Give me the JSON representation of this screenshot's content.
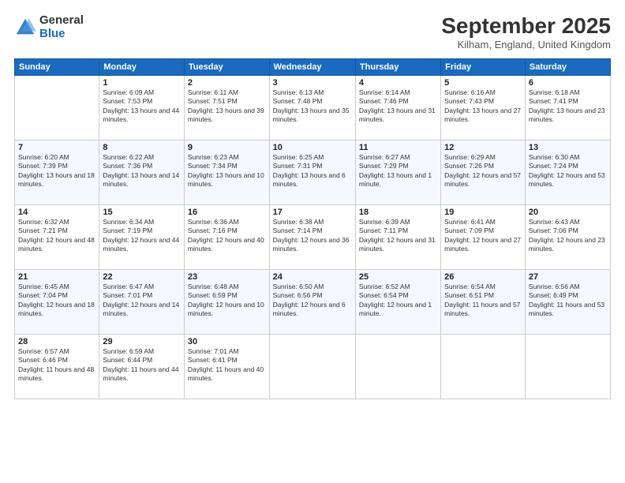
{
  "logo": {
    "general": "General",
    "blue": "Blue"
  },
  "title": "September 2025",
  "location": "Kilham, England, United Kingdom",
  "days_of_week": [
    "Sunday",
    "Monday",
    "Tuesday",
    "Wednesday",
    "Thursday",
    "Friday",
    "Saturday"
  ],
  "weeks": [
    [
      {
        "day": "",
        "sunrise": "",
        "sunset": "",
        "daylight": ""
      },
      {
        "day": "1",
        "sunrise": "Sunrise: 6:09 AM",
        "sunset": "Sunset: 7:53 PM",
        "daylight": "Daylight: 13 hours and 44 minutes."
      },
      {
        "day": "2",
        "sunrise": "Sunrise: 6:11 AM",
        "sunset": "Sunset: 7:51 PM",
        "daylight": "Daylight: 13 hours and 39 minutes."
      },
      {
        "day": "3",
        "sunrise": "Sunrise: 6:13 AM",
        "sunset": "Sunset: 7:48 PM",
        "daylight": "Daylight: 13 hours and 35 minutes."
      },
      {
        "day": "4",
        "sunrise": "Sunrise: 6:14 AM",
        "sunset": "Sunset: 7:46 PM",
        "daylight": "Daylight: 13 hours and 31 minutes."
      },
      {
        "day": "5",
        "sunrise": "Sunrise: 6:16 AM",
        "sunset": "Sunset: 7:43 PM",
        "daylight": "Daylight: 13 hours and 27 minutes."
      },
      {
        "day": "6",
        "sunrise": "Sunrise: 6:18 AM",
        "sunset": "Sunset: 7:41 PM",
        "daylight": "Daylight: 13 hours and 23 minutes."
      }
    ],
    [
      {
        "day": "7",
        "sunrise": "Sunrise: 6:20 AM",
        "sunset": "Sunset: 7:39 PM",
        "daylight": "Daylight: 13 hours and 18 minutes."
      },
      {
        "day": "8",
        "sunrise": "Sunrise: 6:22 AM",
        "sunset": "Sunset: 7:36 PM",
        "daylight": "Daylight: 13 hours and 14 minutes."
      },
      {
        "day": "9",
        "sunrise": "Sunrise: 6:23 AM",
        "sunset": "Sunset: 7:34 PM",
        "daylight": "Daylight: 13 hours and 10 minutes."
      },
      {
        "day": "10",
        "sunrise": "Sunrise: 6:25 AM",
        "sunset": "Sunset: 7:31 PM",
        "daylight": "Daylight: 13 hours and 6 minutes."
      },
      {
        "day": "11",
        "sunrise": "Sunrise: 6:27 AM",
        "sunset": "Sunset: 7:29 PM",
        "daylight": "Daylight: 13 hours and 1 minute."
      },
      {
        "day": "12",
        "sunrise": "Sunrise: 6:29 AM",
        "sunset": "Sunset: 7:26 PM",
        "daylight": "Daylight: 12 hours and 57 minutes."
      },
      {
        "day": "13",
        "sunrise": "Sunrise: 6:30 AM",
        "sunset": "Sunset: 7:24 PM",
        "daylight": "Daylight: 12 hours and 53 minutes."
      }
    ],
    [
      {
        "day": "14",
        "sunrise": "Sunrise: 6:32 AM",
        "sunset": "Sunset: 7:21 PM",
        "daylight": "Daylight: 12 hours and 48 minutes."
      },
      {
        "day": "15",
        "sunrise": "Sunrise: 6:34 AM",
        "sunset": "Sunset: 7:19 PM",
        "daylight": "Daylight: 12 hours and 44 minutes."
      },
      {
        "day": "16",
        "sunrise": "Sunrise: 6:36 AM",
        "sunset": "Sunset: 7:16 PM",
        "daylight": "Daylight: 12 hours and 40 minutes."
      },
      {
        "day": "17",
        "sunrise": "Sunrise: 6:38 AM",
        "sunset": "Sunset: 7:14 PM",
        "daylight": "Daylight: 12 hours and 36 minutes."
      },
      {
        "day": "18",
        "sunrise": "Sunrise: 6:39 AM",
        "sunset": "Sunset: 7:11 PM",
        "daylight": "Daylight: 12 hours and 31 minutes."
      },
      {
        "day": "19",
        "sunrise": "Sunrise: 6:41 AM",
        "sunset": "Sunset: 7:09 PM",
        "daylight": "Daylight: 12 hours and 27 minutes."
      },
      {
        "day": "20",
        "sunrise": "Sunrise: 6:43 AM",
        "sunset": "Sunset: 7:06 PM",
        "daylight": "Daylight: 12 hours and 23 minutes."
      }
    ],
    [
      {
        "day": "21",
        "sunrise": "Sunrise: 6:45 AM",
        "sunset": "Sunset: 7:04 PM",
        "daylight": "Daylight: 12 hours and 18 minutes."
      },
      {
        "day": "22",
        "sunrise": "Sunrise: 6:47 AM",
        "sunset": "Sunset: 7:01 PM",
        "daylight": "Daylight: 12 hours and 14 minutes."
      },
      {
        "day": "23",
        "sunrise": "Sunrise: 6:48 AM",
        "sunset": "Sunset: 6:59 PM",
        "daylight": "Daylight: 12 hours and 10 minutes."
      },
      {
        "day": "24",
        "sunrise": "Sunrise: 6:50 AM",
        "sunset": "Sunset: 6:56 PM",
        "daylight": "Daylight: 12 hours and 6 minutes."
      },
      {
        "day": "25",
        "sunrise": "Sunrise: 6:52 AM",
        "sunset": "Sunset: 6:54 PM",
        "daylight": "Daylight: 12 hours and 1 minute."
      },
      {
        "day": "26",
        "sunrise": "Sunrise: 6:54 AM",
        "sunset": "Sunset: 6:51 PM",
        "daylight": "Daylight: 11 hours and 57 minutes."
      },
      {
        "day": "27",
        "sunrise": "Sunrise: 6:56 AM",
        "sunset": "Sunset: 6:49 PM",
        "daylight": "Daylight: 11 hours and 53 minutes."
      }
    ],
    [
      {
        "day": "28",
        "sunrise": "Sunrise: 6:57 AM",
        "sunset": "Sunset: 6:46 PM",
        "daylight": "Daylight: 11 hours and 48 minutes."
      },
      {
        "day": "29",
        "sunrise": "Sunrise: 6:59 AM",
        "sunset": "Sunset: 6:44 PM",
        "daylight": "Daylight: 11 hours and 44 minutes."
      },
      {
        "day": "30",
        "sunrise": "Sunrise: 7:01 AM",
        "sunset": "Sunset: 6:41 PM",
        "daylight": "Daylight: 11 hours and 40 minutes."
      },
      {
        "day": "",
        "sunrise": "",
        "sunset": "",
        "daylight": ""
      },
      {
        "day": "",
        "sunrise": "",
        "sunset": "",
        "daylight": ""
      },
      {
        "day": "",
        "sunrise": "",
        "sunset": "",
        "daylight": ""
      },
      {
        "day": "",
        "sunrise": "",
        "sunset": "",
        "daylight": ""
      }
    ]
  ]
}
